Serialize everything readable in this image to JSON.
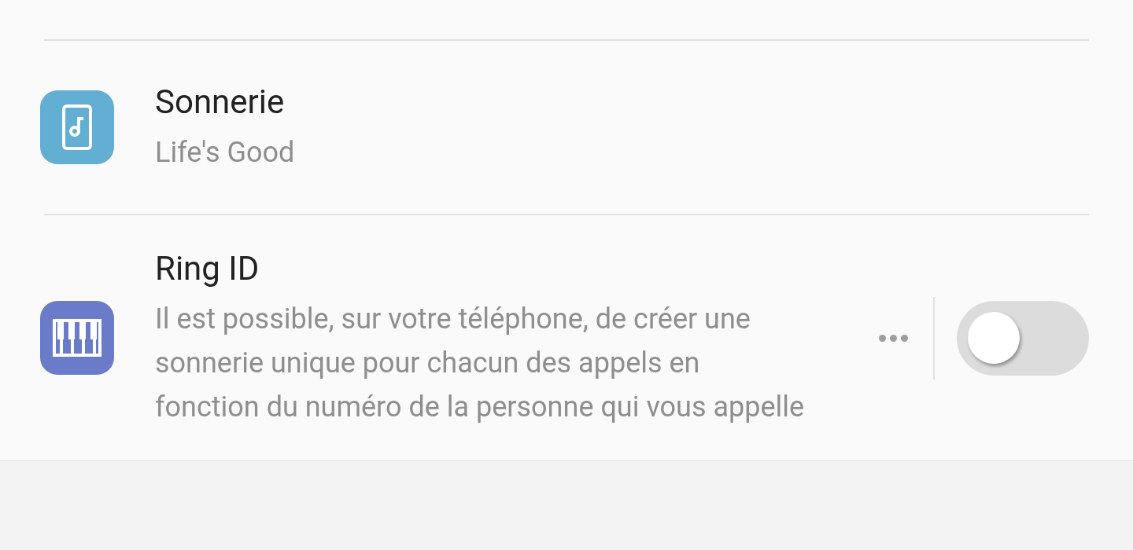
{
  "settings": [
    {
      "kind": "link",
      "title": "Sonnerie",
      "subtitle": "Life's Good",
      "color": "#62afd3"
    },
    {
      "kind": "toggle",
      "title": "Ring ID",
      "subtitle": "Il est possible, sur votre téléphone, de créer une sonnerie unique pour chacun des appels en fonction du numéro de la personne qui vous appelle",
      "color": "#6a7bc9",
      "on": false
    }
  ]
}
